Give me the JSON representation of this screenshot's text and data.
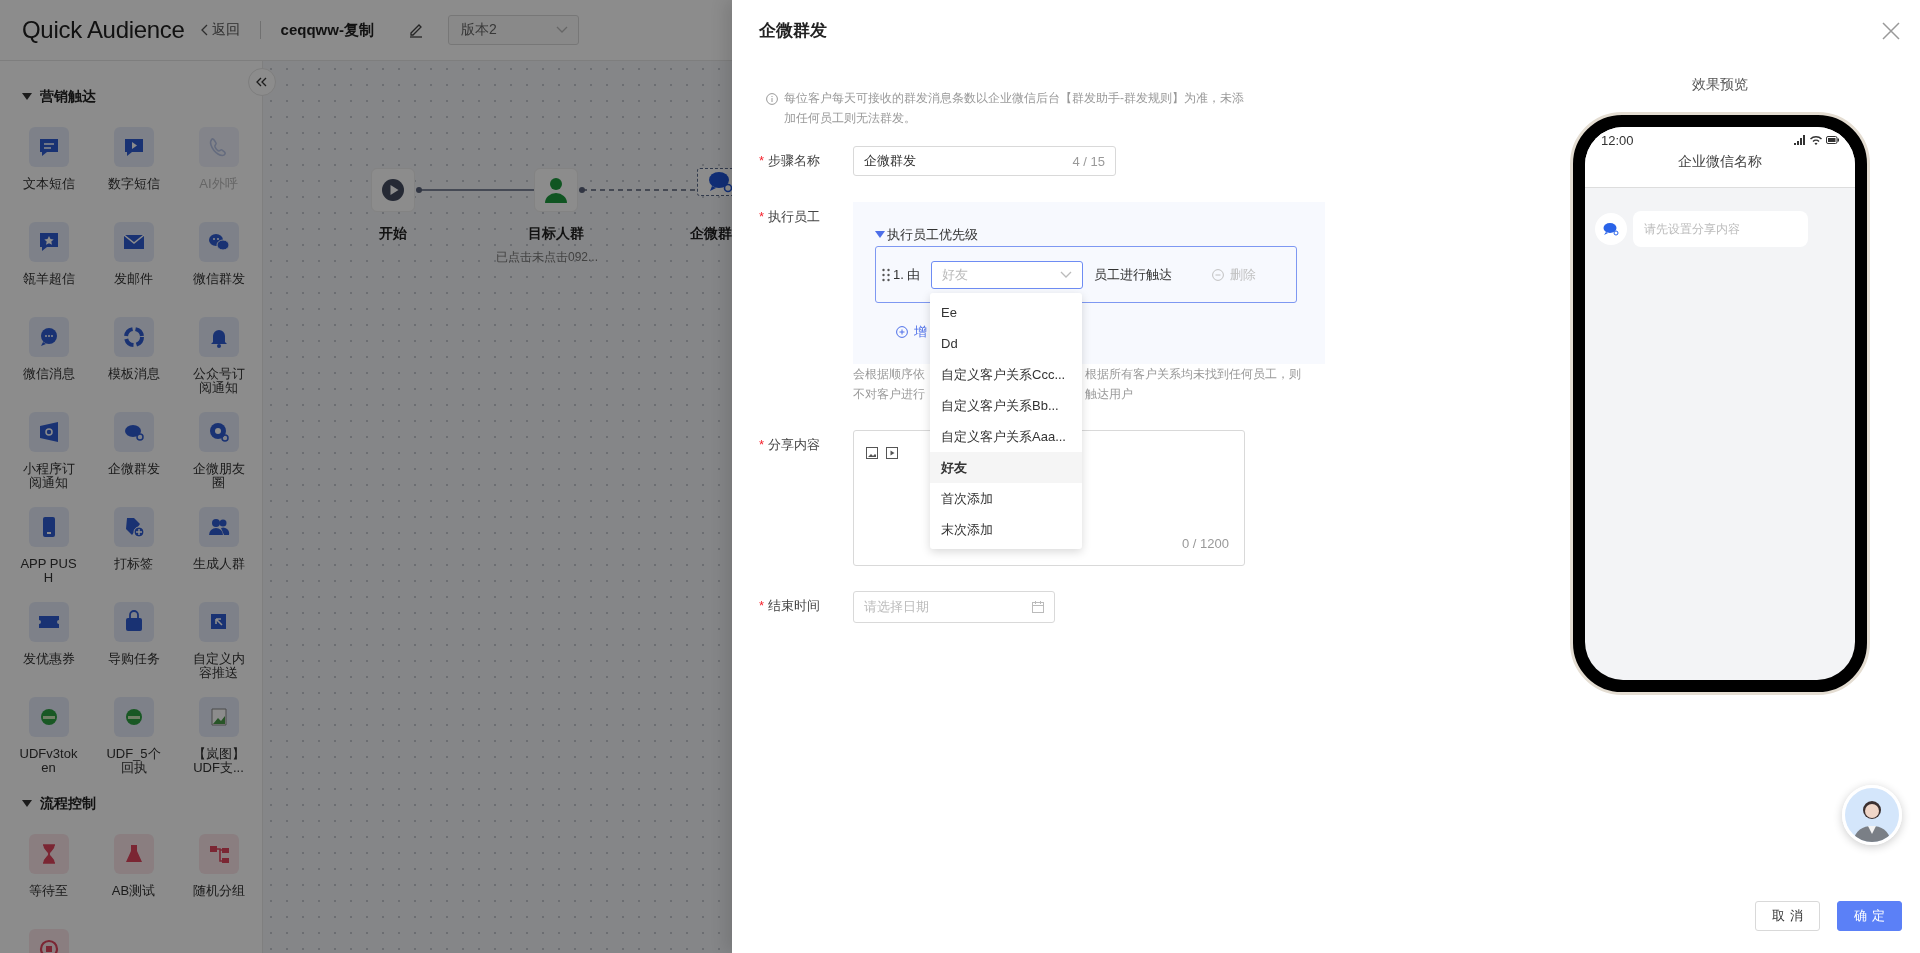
{
  "header": {
    "logo": "Quick Audience",
    "back": "返回",
    "journey_name": "ceqqww-复制",
    "version": {
      "value": "版本2",
      "disabled": true
    }
  },
  "sidebar": {
    "sections": [
      {
        "title": "营销触达",
        "kind": "reach",
        "items": [
          {
            "label": "文本短信",
            "disabled": false
          },
          {
            "label": "数字短信",
            "disabled": false
          },
          {
            "label": "AI外呼",
            "disabled": true
          },
          {
            "label": "瓴羊超信",
            "disabled": false
          },
          {
            "label": "发邮件",
            "disabled": false
          },
          {
            "label": "微信群发",
            "disabled": false
          },
          {
            "label": "微信消息",
            "disabled": false
          },
          {
            "label": "模板消息",
            "disabled": false
          },
          {
            "label": "公众号订阅通知",
            "disabled": false
          },
          {
            "label": "小程序订阅通知",
            "disabled": false
          },
          {
            "label": "企微群发",
            "disabled": false
          },
          {
            "label": "企微朋友圈",
            "disabled": false
          },
          {
            "label": "APP PUSH",
            "disabled": false
          },
          {
            "label": "打标签",
            "disabled": false
          },
          {
            "label": "生成人群",
            "disabled": false
          },
          {
            "label": "发优惠券",
            "disabled": false
          },
          {
            "label": "导购任务",
            "disabled": false
          },
          {
            "label": "自定义内容推送",
            "disabled": false
          },
          {
            "label": "UDFv3token",
            "disabled": false
          },
          {
            "label": "UDF_5个回执",
            "disabled": false
          },
          {
            "label": "【岚图】UDF支...",
            "disabled": false
          }
        ]
      },
      {
        "title": "流程控制",
        "kind": "flow",
        "items": [
          {
            "label": "等待至",
            "disabled": false
          },
          {
            "label": "AB测试",
            "disabled": false
          },
          {
            "label": "随机分组",
            "disabled": false
          },
          {
            "disabled": false
          }
        ]
      }
    ]
  },
  "canvas": {
    "nodes": [
      {
        "label": "开始",
        "kind": "start",
        "selected": false
      },
      {
        "label": "目标人群",
        "subtitle": "已点击未点击092...",
        "kind": "audience",
        "selected": false
      },
      {
        "label": "企微群",
        "kind": "wecom",
        "selected": true
      }
    ]
  },
  "drawer": {
    "title": "企微群发",
    "notice": "每位客户每天可接收的群发消息条数以企业微信后台【群发助手-群发规则】为准，未添加任何员工则无法群发。",
    "step_name": {
      "required_mark": "*",
      "label": "步骤名称",
      "value": "企微群发",
      "counter": "4 / 15"
    },
    "executor": {
      "required_mark": "*",
      "label": "执行员工",
      "group_title": "执行员工优先级",
      "expanded": true,
      "rules": [
        {
          "index": "1. 由",
          "select": {
            "value": "好友",
            "open": true
          },
          "suffix": "员工进行触达",
          "delete": "删除",
          "delete_disabled": true
        }
      ],
      "add": "增",
      "options": [
        {
          "label": "Ee",
          "selected": false
        },
        {
          "label": "Dd",
          "selected": false
        },
        {
          "label": "自定义客户关系Ccc...",
          "selected": false
        },
        {
          "label": "自定义客户关系Bb...",
          "selected": false
        },
        {
          "label": "自定义客户关系Aaa...",
          "selected": false
        },
        {
          "label": "好友",
          "selected": true
        },
        {
          "label": "首次添加",
          "selected": false
        },
        {
          "label": "末次添加",
          "selected": false
        }
      ],
      "help_lines": [
        {
          "left": "会根据顺序依",
          "right": "根据所有客户关系均未找到任何员工，则"
        },
        {
          "left": "不对客户进行",
          "right": "触达用户"
        }
      ]
    },
    "share_content": {
      "required_mark": "*",
      "label": "分享内容",
      "counter": "0 / 1200"
    },
    "end_time": {
      "required_mark": "*",
      "label": "结束时间",
      "placeholder": "请选择日期"
    },
    "preview": {
      "title": "效果预览",
      "time": "12:00",
      "chat_title": "企业微信名称",
      "placeholder": "请先设置分享内容"
    },
    "buttons": [
      {
        "label": "取消",
        "kind": "default"
      },
      {
        "label": "确定",
        "kind": "primary"
      }
    ]
  }
}
